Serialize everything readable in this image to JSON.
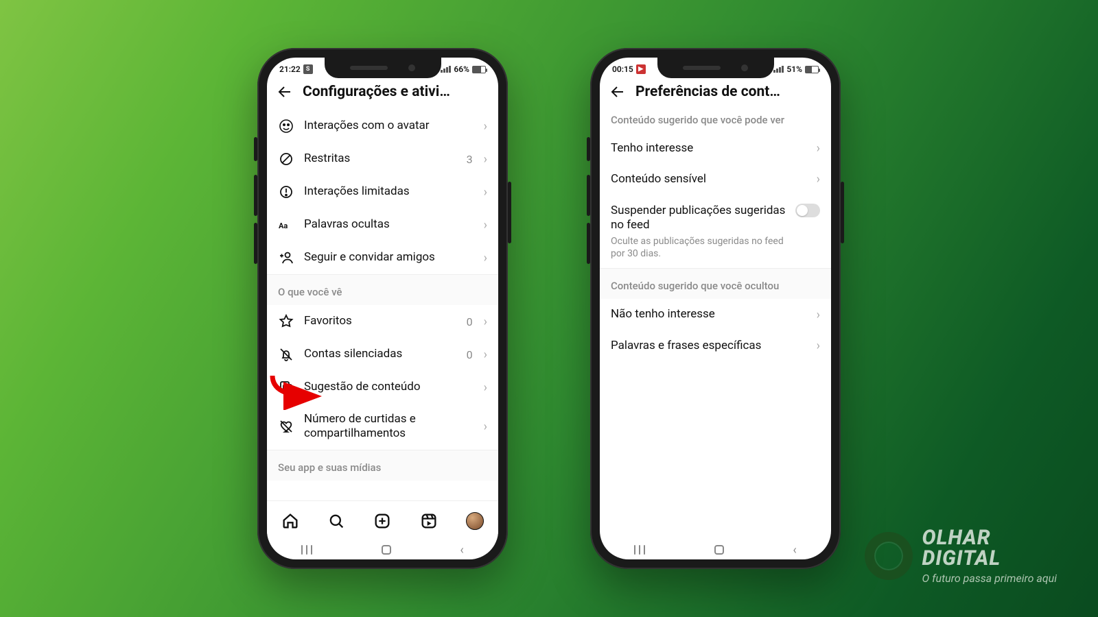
{
  "watermark": {
    "line1": "OLHAR",
    "line2": "DIGITAL",
    "tagline": "O futuro passa primeiro aqui"
  },
  "phone1": {
    "status": {
      "time": "21:22",
      "badge": "S",
      "battery_pct": "66%"
    },
    "header": {
      "title": "Configurações e ativi…"
    },
    "rows": [
      {
        "icon": "avatar-icon",
        "label": "Interações com o avatar",
        "meta": ""
      },
      {
        "icon": "block-icon",
        "label": "Restritas",
        "meta": "3"
      },
      {
        "icon": "alert-icon",
        "label": "Interações limitadas",
        "meta": ""
      },
      {
        "icon": "text-icon",
        "label": "Palavras ocultas",
        "meta": ""
      },
      {
        "icon": "user-plus-icon",
        "label": "Seguir e convidar amigos",
        "meta": ""
      }
    ],
    "section1": "O que você vê",
    "rows2": [
      {
        "icon": "star-icon",
        "label": "Favoritos",
        "meta": "0"
      },
      {
        "icon": "bell-off-icon",
        "label": "Contas silenciadas",
        "meta": "0"
      },
      {
        "icon": "cards-icon",
        "label": "Sugestão de conteúdo",
        "meta": ""
      },
      {
        "icon": "heart-off-icon",
        "label": "Número de curtidas e compartilhamentos",
        "meta": ""
      }
    ],
    "section2": "Seu app e suas mídias"
  },
  "phone2": {
    "status": {
      "time": "00:15",
      "badge": "▶",
      "battery_pct": "51%"
    },
    "header": {
      "title": "Preferências de cont…"
    },
    "section1": "Conteúdo sugerido que você pode ver",
    "rows": [
      {
        "label": "Tenho interesse"
      },
      {
        "label": "Conteúdo sensível"
      }
    ],
    "toggle": {
      "title": "Suspender publicações sugeridas no feed",
      "sub": "Oculte as publicações sugeridas no feed por 30 dias."
    },
    "section2": "Conteúdo sugerido que você ocultou",
    "rows2": [
      {
        "label": "Não tenho interesse"
      },
      {
        "label": "Palavras e frases específicas"
      }
    ]
  }
}
